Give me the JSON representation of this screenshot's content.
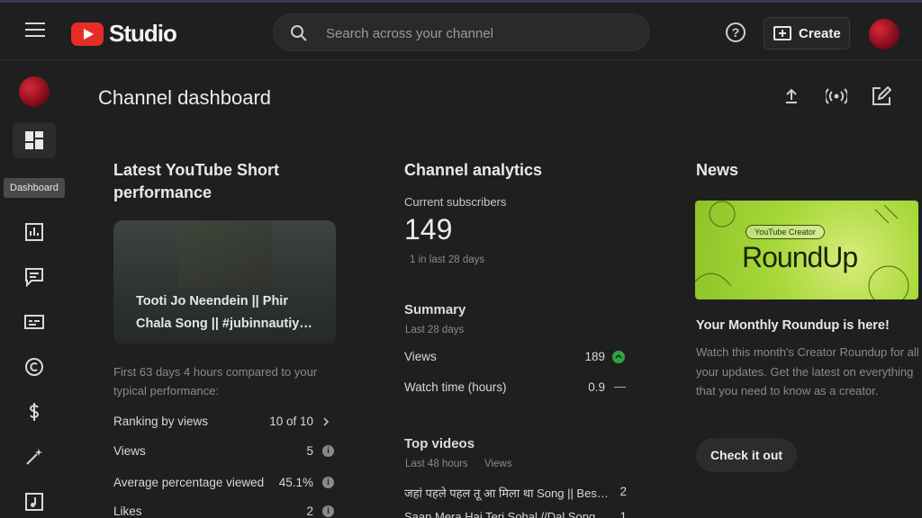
{
  "app": {
    "logo_text": "Studio",
    "brand_color": "#e52d27"
  },
  "header": {
    "search_placeholder": "Search across your channel",
    "help_symbol": "?",
    "create_label": "Create"
  },
  "sidebar": {
    "tooltip": "Dashboard",
    "items": [
      {
        "name": "dashboard",
        "icon": "dashboard-icon",
        "active": true
      },
      {
        "name": "analytics",
        "icon": "analytics-icon"
      },
      {
        "name": "comments",
        "icon": "comments-icon"
      },
      {
        "name": "subtitles",
        "icon": "subtitles-icon"
      },
      {
        "name": "copyright",
        "icon": "copyright-icon"
      },
      {
        "name": "earn",
        "icon": "dollar-icon"
      },
      {
        "name": "customization",
        "icon": "magic-wand-icon"
      },
      {
        "name": "audio-library",
        "icon": "music-note-icon"
      }
    ]
  },
  "page": {
    "title": "Channel dashboard",
    "tools": [
      "upload-icon",
      "go-live-icon",
      "create-post-icon"
    ]
  },
  "short_card": {
    "title": "Latest YouTube Short performance",
    "video_title": "Tooti Jo Neendein || Phir Chala Song || #jubinnautiy…",
    "comparison": "First 63 days 4 hours compared to your typical performance:",
    "rows": [
      {
        "label": "Ranking by views",
        "value": "10 of 10",
        "indicator": "chevron"
      },
      {
        "label": "Views",
        "value": "5",
        "indicator": "info"
      },
      {
        "label": "Average percentage viewed",
        "value": "45.1%",
        "indicator": "info"
      },
      {
        "label": "Likes",
        "value": "2",
        "indicator": "info"
      }
    ]
  },
  "analytics": {
    "title": "Channel analytics",
    "subscribers_label": "Current subscribers",
    "subscribers_value": "149",
    "subscribers_delta": "1 in last 28 days",
    "summary_title": "Summary",
    "summary_period": "Last 28 days",
    "summary_rows": [
      {
        "label": "Views",
        "value": "189",
        "indicator": "up",
        "color": "#2ba640"
      },
      {
        "label": "Watch time (hours)",
        "value": "0.9",
        "indicator": "—"
      }
    ],
    "top_videos_title": "Top videos",
    "top_videos_period": "Last 48 hours",
    "top_videos_metric": "Views",
    "top_videos": [
      {
        "title": "जहां पहले पहल तू आ मिला था Song || Bes…",
        "views": "2"
      },
      {
        "title": "Saan Mera Hai Teri Sohal //Dal Song…",
        "views": "1"
      }
    ]
  },
  "news": {
    "title": "News",
    "banner_chip": "YouTube Creator",
    "banner_text": "RoundUp",
    "headline": "Your Monthly Roundup is here!",
    "body": "Watch this month's Creator Roundup for all your updates. Get the latest on everything that you need to know as a creator.",
    "cta": "Check it out"
  }
}
